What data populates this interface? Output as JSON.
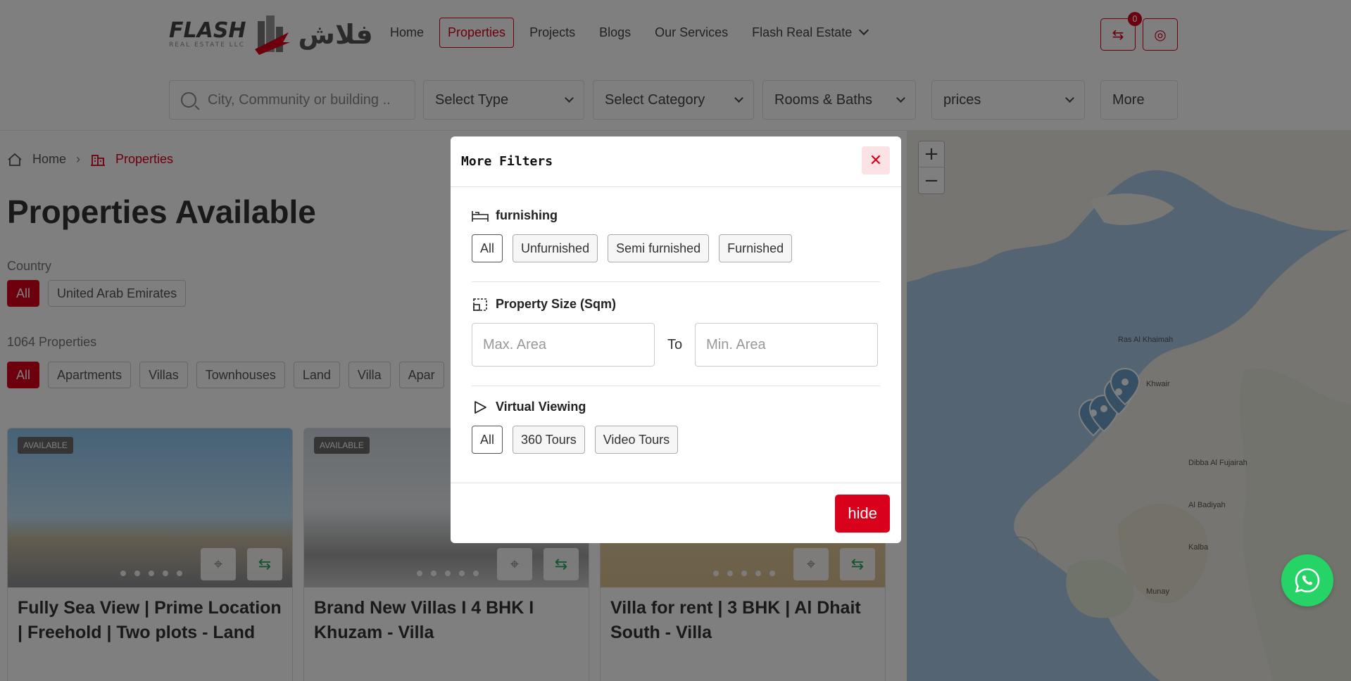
{
  "header": {
    "logo_text": "FLASH",
    "logo_sub": "REAL ESTATE LLC",
    "logo_arabic": "فلاش",
    "nav": [
      {
        "label": "Home"
      },
      {
        "label": "Properties"
      },
      {
        "label": "Projects"
      },
      {
        "label": "Blogs"
      },
      {
        "label": "Our Services"
      },
      {
        "label": "Flash Real Estate"
      }
    ],
    "compare_count": "0"
  },
  "filters": {
    "search_placeholder": "City, Community or building ..",
    "type": "Select Type",
    "category": "Select Category",
    "rooms": "Rooms & Baths",
    "prices": "prices",
    "more": "More"
  },
  "breadcrumb": {
    "home": "Home",
    "current": "Properties"
  },
  "page_title": "Properties Available",
  "country": {
    "label": "Country",
    "options": [
      "All",
      "United Arab Emirates"
    ]
  },
  "count_label": "1064 Properties",
  "types": [
    "All",
    "Apartments",
    "Villas",
    "Townhouses",
    "Land",
    "Villa",
    "Apar"
  ],
  "cards": [
    {
      "badge": "AVAILABLE",
      "title": "Fully Sea View | Prime Location | Freehold | Two plots - Land"
    },
    {
      "badge": "AVAILABLE",
      "title": "Brand New Villas I 4 BHK I Khuzam - Villa"
    },
    {
      "badge": "",
      "title": "Villa for rent | 3 BHK | Al Dhait South - Villa"
    }
  ],
  "map": {
    "zoom_in": "+",
    "zoom_out": "−",
    "places": [
      "Khwair",
      "Dibba Al Fujairah",
      "Al Badiyah",
      "Kalba",
      "Munay",
      "Ras Al Khaimah"
    ]
  },
  "modal": {
    "title": "More Filters",
    "close": "✕",
    "furnishing": {
      "label": "furnishing",
      "options": [
        "All",
        "Unfurnished",
        "Semi furnished",
        "Furnished"
      ]
    },
    "size": {
      "label": "Property Size (Sqm)",
      "max_placeholder": "Max. Area",
      "to": "To",
      "min_placeholder": "Min. Area"
    },
    "virtual": {
      "label": "Virtual Viewing",
      "options": [
        "All",
        "360 Tours",
        "Video Tours"
      ]
    },
    "hide": "hide"
  },
  "colors": {
    "accent": "#d9001b",
    "whatsapp": "#25d366"
  }
}
